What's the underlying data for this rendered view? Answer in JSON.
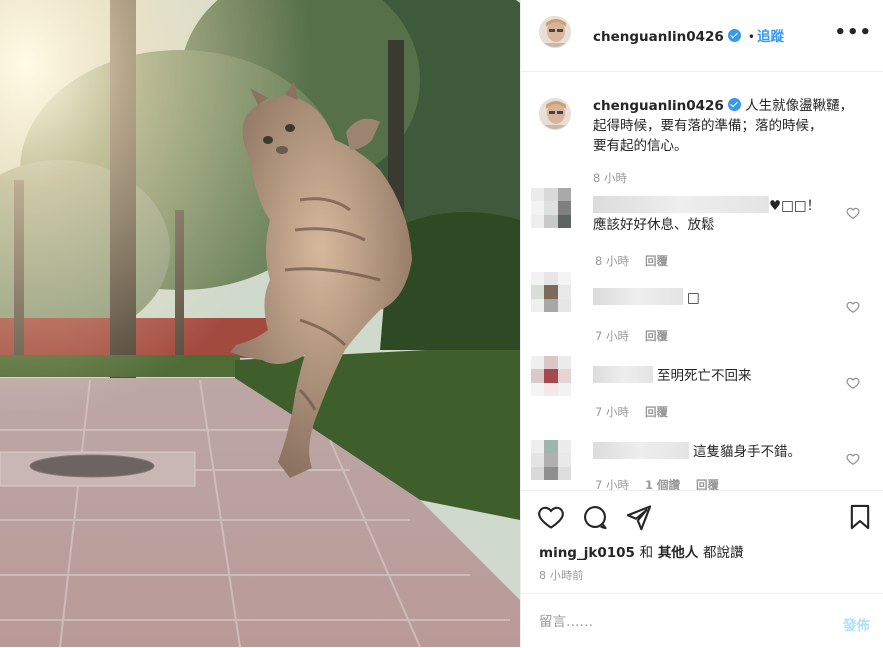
{
  "post": {
    "username": "chenguanlin0426",
    "separator": "•",
    "follow_label": "追蹤",
    "more_label": "•••",
    "caption_lines": [
      "人生就像盪鞦韆，",
      "起得時候，要有落的準備；落的時候，",
      "要有起的信心。"
    ],
    "caption_time": "8 小時"
  },
  "comments": [
    {
      "text": "♥□□！",
      "text2": "應該好好休息、放鬆",
      "time": "8 小時",
      "reply": "回覆"
    },
    {
      "text": "□",
      "time": "7 小時",
      "reply": "回覆"
    },
    {
      "text": "至明死亡不回来",
      "time": "7 小時",
      "reply": "回覆"
    },
    {
      "text": "這隻貓身手不錯。",
      "time": "7 小時",
      "likes": "1 個讚",
      "reply": "回覆"
    }
  ],
  "footer": {
    "likes_user": "ming_jk0105",
    "likes_and": "和",
    "likes_others": "其他人",
    "likes_suffix": "都說讚",
    "time_ago": "8 小時前",
    "comment_placeholder": "留言……",
    "post_label": "發佈"
  },
  "colors": {
    "accent": "#3897f0",
    "post_disabled": "#b2dffc",
    "muted": "#999999"
  },
  "icons": [
    "verified-badge-icon",
    "more-options-icon",
    "heart-icon",
    "comment-icon",
    "share-icon",
    "bookmark-icon"
  ]
}
